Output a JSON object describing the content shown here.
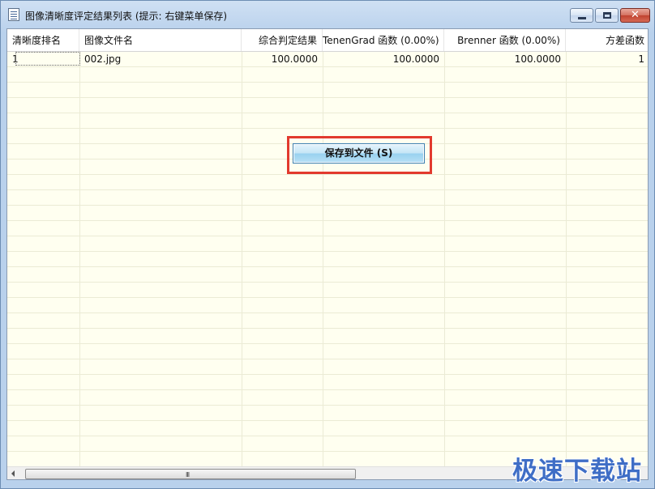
{
  "window": {
    "title": "图像清晰度评定结果列表 (提示: 右键菜单保存)",
    "controls": {
      "minimize": "minimize",
      "maximize": "maximize",
      "close": "✕"
    }
  },
  "table": {
    "columns": [
      "清晰度排名",
      "图像文件名",
      "综合判定结果",
      "TenenGrad 函数 (0.00%)",
      "Brenner 函数 (0.00%)",
      "方差函数"
    ],
    "rows": [
      [
        "1",
        "002.jpg",
        "100.0000",
        "100.0000",
        "100.0000",
        "1"
      ]
    ]
  },
  "save_button": {
    "label": "保存到文件    (S)"
  },
  "scrollbar": {
    "grip": "III"
  },
  "watermark": {
    "text": "极速下载站"
  },
  "colors": {
    "highlight_box": "#e23a2e",
    "list_background": "#fffff0",
    "watermark": "#3f6ec6"
  }
}
